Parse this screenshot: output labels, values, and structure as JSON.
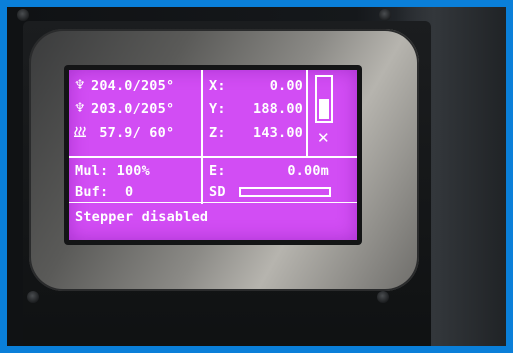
{
  "lcd": {
    "hotend1": {
      "current": "204.0",
      "target": "205°",
      "text": "204.0/205°"
    },
    "hotend2": {
      "current": "203.0",
      "target": "205°",
      "text": "203.0/205°"
    },
    "bed": {
      "current": " 57.9",
      "target": " 60°",
      "text": " 57.9/ 60°"
    },
    "axes": [
      {
        "label": "X:",
        "value": "0.00"
      },
      {
        "label": "Y:",
        "value": "188.00"
      },
      {
        "label": "Z:",
        "value": "143.00"
      }
    ],
    "multiplier": "Mul: 100%",
    "buffer": "Buf:  0",
    "extruder": {
      "label": "E:",
      "value": "0.00m"
    },
    "sd_label": "SD",
    "sd_progress": 0,
    "status": "Stepper disabled",
    "level_indicator": 0.5
  },
  "icons": {
    "hotend": "hotend-icon",
    "bed": "heated-bed-icon",
    "fan": "fan-icon"
  },
  "colors": {
    "lcd_background": "#d24df4",
    "lcd_text": "#ffffff",
    "frame_border": "#0a7fd9"
  }
}
